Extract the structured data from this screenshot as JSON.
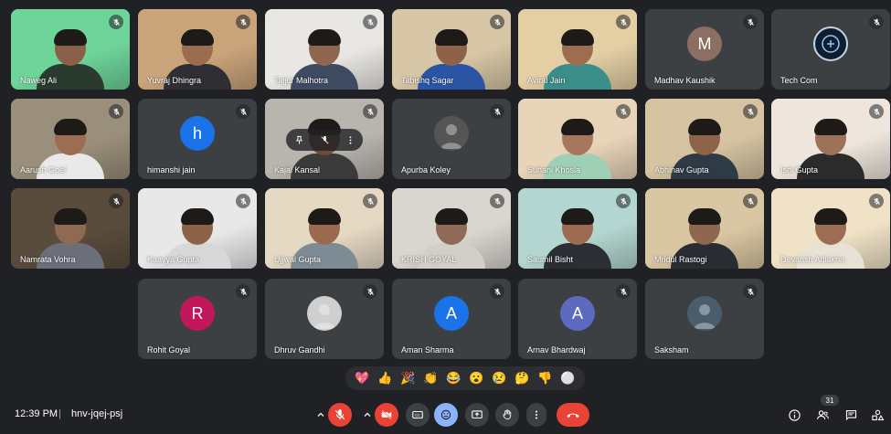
{
  "participants": [
    {
      "name": "Naweg Ali",
      "type": "video",
      "bg": "#6fd49a",
      "skin": "#8a6048",
      "shirt": "#2b3a2f"
    },
    {
      "name": "Yuvraj Dhingra",
      "type": "video",
      "bg": "#caa47a",
      "skin": "#9a6c50",
      "shirt": "#2f2f33"
    },
    {
      "name": "Tajjur Malhotra",
      "type": "video",
      "bg": "#e9e7e3",
      "skin": "#8f6650",
      "shirt": "#3d4a62"
    },
    {
      "name": "Tabishq Sagar",
      "type": "video",
      "bg": "#d8c7a6",
      "skin": "#8d6247",
      "shirt": "#2a55a5"
    },
    {
      "name": "Aviral Jain",
      "type": "video",
      "bg": "#e3cfa3",
      "skin": "#9d6d4f",
      "shirt": "#3b8d8a"
    },
    {
      "name": "Madhav Kaushik",
      "type": "avatar",
      "letter": "M",
      "color": "#8d6e63"
    },
    {
      "name": "Tech Com",
      "type": "logo",
      "color": "#3c4043"
    },
    {
      "name": "Aarush Goel",
      "type": "video",
      "bg": "#9a8f7a",
      "skin": "#9b6d52",
      "shirt": "#e9e9e9"
    },
    {
      "name": "himanshi jain",
      "type": "avatar",
      "letter": "h",
      "color": "#1a73e8"
    },
    {
      "name": "Kajal Kansal",
      "type": "video",
      "bg": "#b8b4ae",
      "skin": "#6e4b3a",
      "shirt": "#3a3a3a"
    },
    {
      "name": "Apurba Koley",
      "type": "photo",
      "color": "#555"
    },
    {
      "name": "Suhani Khosla",
      "type": "video",
      "bg": "#e8d4b8",
      "skin": "#a5785d",
      "shirt": "#9fd0b6"
    },
    {
      "name": "Abhinav Gupta",
      "type": "video",
      "bg": "#d5c3a1",
      "skin": "#8d6349",
      "shirt": "#2e3b47"
    },
    {
      "name": "Ishi Gupta",
      "type": "video",
      "bg": "#eee6dc",
      "skin": "#9d7258",
      "shirt": "#2b2b2b"
    },
    {
      "name": "Namrata Vohra",
      "type": "video",
      "bg": "#5a4c3c",
      "skin": "#8f6a53",
      "shirt": "#6a6f7a"
    },
    {
      "name": "Kaavya Gupta",
      "type": "video",
      "bg": "#e8e8e8",
      "skin": "#8d6249",
      "shirt": "#d8d8d8"
    },
    {
      "name": "Ujjwal Gupta",
      "type": "video",
      "bg": "#e5d9c3",
      "skin": "#9a6a4f",
      "shirt": "#7d8b94"
    },
    {
      "name": "KRISH GOYAL",
      "type": "video",
      "bg": "#d9d5cf",
      "skin": "#8f6a56",
      "shirt": "#d2cfc8"
    },
    {
      "name": "Saumil Bisht",
      "type": "video",
      "bg": "#b3d6d0",
      "skin": "#9b6a50",
      "shirt": "#2b2f35"
    },
    {
      "name": "Mridul Rastogi",
      "type": "video",
      "bg": "#d9c6a2",
      "skin": "#8f664f",
      "shirt": "#2a2c33"
    },
    {
      "name": "Devansh Adlakha",
      "type": "video",
      "bg": "#f0e2c6",
      "skin": "#9b6d52",
      "shirt": "#e8e2d6"
    },
    {
      "name": "Rohit Goyal",
      "type": "avatar",
      "letter": "R",
      "color": "#c2185b"
    },
    {
      "name": "Dhruv Gandhi",
      "type": "photo",
      "color": "#cfcfcf"
    },
    {
      "name": "Aman Sharma",
      "type": "avatar",
      "letter": "A",
      "color": "#1a73e8"
    },
    {
      "name": "Arnav Bhardwaj",
      "type": "avatar",
      "letter": "A",
      "color": "#5c6bc0"
    },
    {
      "name": "Saksham",
      "type": "photo",
      "color": "#4a5d6d"
    }
  ],
  "reactions": [
    "💖",
    "👍",
    "🎉",
    "👏",
    "😂",
    "😮",
    "😢",
    "🤔",
    "👎",
    "⚪"
  ],
  "footer": {
    "time": "12:39 PM",
    "separator": "|",
    "meeting_code": "hnv-jqej-psj",
    "people_count": "31"
  },
  "colors": {
    "background": "#202124",
    "tile": "#3c4043",
    "end_call": "#ea4335",
    "accent": "#8ab4f8"
  }
}
